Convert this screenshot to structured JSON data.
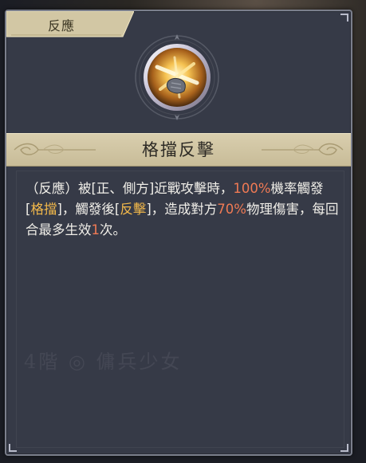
{
  "tab": {
    "label": "反應"
  },
  "skill": {
    "icon": "crossed-swords-parry-icon",
    "title": "格擋反擊",
    "description": {
      "p1": "（反應）被[正、側方]近戰攻擊時，",
      "n1": "100%",
      "p2": "機率觸發[",
      "k1": "格擋",
      "p3": "]，觸發後[",
      "k2": "反擊",
      "p4": "]，造成對方",
      "n2": "70%",
      "p5": "物理傷害，每回合最多生效",
      "n3": "1",
      "p6": "次。"
    }
  },
  "watermark": {
    "text": "4階 ◎ 傭兵少女"
  },
  "colors": {
    "panel": "#363a47",
    "title_band": "#d9ceae",
    "highlight_number": "#f07a54",
    "highlight_keyword": "#f2b84a"
  }
}
